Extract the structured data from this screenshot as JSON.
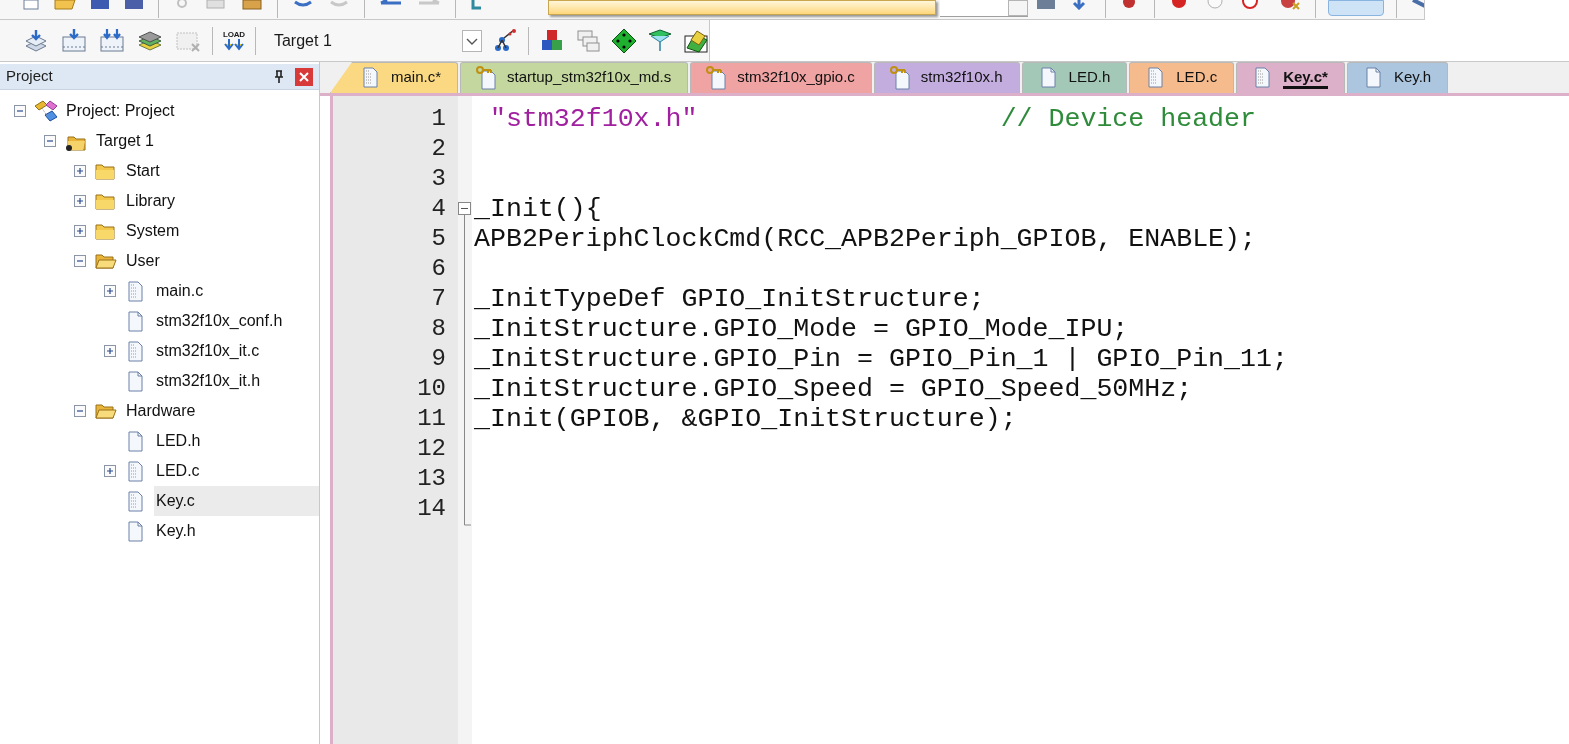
{
  "toolbar": {
    "load_label": "LOAD",
    "target_select": {
      "value": "Target 1"
    }
  },
  "project_panel": {
    "title": "Project",
    "tree": [
      {
        "kind": "project",
        "label": "Project: Project",
        "expanded": true,
        "selected": false,
        "children": [
          {
            "kind": "target",
            "label": "Target 1",
            "expanded": true,
            "selected": false,
            "children": [
              {
                "kind": "folder",
                "label": "Start",
                "expanded": false,
                "selected": false
              },
              {
                "kind": "folder",
                "label": "Library",
                "expanded": false,
                "selected": false
              },
              {
                "kind": "folder",
                "label": "System",
                "expanded": false,
                "selected": false
              },
              {
                "kind": "folder",
                "label": "User",
                "expanded": true,
                "selected": false,
                "children": [
                  {
                    "kind": "file",
                    "label": "main.c",
                    "expanded": false,
                    "selected": false
                  },
                  {
                    "kind": "header",
                    "label": "stm32f10x_conf.h",
                    "selected": false
                  },
                  {
                    "kind": "file",
                    "label": "stm32f10x_it.c",
                    "expanded": false,
                    "selected": false
                  },
                  {
                    "kind": "header",
                    "label": "stm32f10x_it.h",
                    "selected": false
                  }
                ]
              },
              {
                "kind": "folder",
                "label": "Hardware",
                "expanded": true,
                "selected": false,
                "children": [
                  {
                    "kind": "header",
                    "label": "LED.h",
                    "selected": false
                  },
                  {
                    "kind": "file",
                    "label": "LED.c",
                    "expanded": false,
                    "selected": false
                  },
                  {
                    "kind": "source",
                    "label": "Key.c",
                    "selected": true
                  },
                  {
                    "kind": "header",
                    "label": "Key.h",
                    "selected": false
                  }
                ]
              }
            ]
          }
        ]
      }
    ]
  },
  "tabs": [
    {
      "label": "main.c*",
      "kind": "source",
      "color": "#fad982",
      "selected": false
    },
    {
      "label": "startup_stm32f10x_md.s",
      "kind": "readonly",
      "color": "#c4d79e",
      "selected": false
    },
    {
      "label": "stm32f10x_gpio.c",
      "kind": "readonly",
      "color": "#f0a3a3",
      "selected": false
    },
    {
      "label": "stm32f10x.h",
      "kind": "readonly",
      "color": "#c3addf",
      "selected": false
    },
    {
      "label": "LED.h",
      "kind": "header",
      "color": "#a3c8b8",
      "selected": false
    },
    {
      "label": "LED.c",
      "kind": "source",
      "color": "#f5bb8d",
      "selected": false
    },
    {
      "label": "Key.c*",
      "kind": "source",
      "color": "#dcb0c8",
      "selected": true
    },
    {
      "label": "Key.h",
      "kind": "header",
      "color": "#abc6de",
      "selected": false
    }
  ],
  "editor": {
    "lines": [
      {
        "number": "1",
        "segments": [
          {
            "kind": "string",
            "text": " \"stm32f10x.h\""
          },
          {
            "kind": "comment",
            "text": "                   // Device header"
          }
        ]
      },
      {
        "number": "2"
      },
      {
        "number": "3"
      },
      {
        "number": "4",
        "fold": true,
        "segments": [
          {
            "kind": "plain",
            "text": "_Init(){"
          }
        ]
      },
      {
        "number": "5",
        "segments": [
          {
            "kind": "plain",
            "text": "APB2PeriphClockCmd(RCC_APB2Periph_GPIOB, ENABLE);"
          }
        ]
      },
      {
        "number": "6"
      },
      {
        "number": "7",
        "segments": [
          {
            "kind": "plain",
            "text": "_InitTypeDef GPIO_InitStructure;"
          }
        ]
      },
      {
        "number": "8",
        "segments": [
          {
            "kind": "plain",
            "text": "_InitStructure.GPIO_Mode = GPIO_Mode_IPU;"
          }
        ]
      },
      {
        "number": "9",
        "segments": [
          {
            "kind": "plain",
            "text": "_InitStructure.GPIO_Pin = GPIO_Pin_1 | GPIO_Pin_11;"
          }
        ]
      },
      {
        "number": "10",
        "segments": [
          {
            "kind": "plain",
            "text": "_InitStructure.GPIO_Speed = GPIO_Speed_50MHz;"
          }
        ]
      },
      {
        "number": "11",
        "segments": [
          {
            "kind": "plain",
            "text": "_Init(GPIOB, &GPIO_InitStructure);"
          }
        ]
      },
      {
        "number": "12"
      },
      {
        "number": "13"
      },
      {
        "number": "14"
      }
    ]
  }
}
